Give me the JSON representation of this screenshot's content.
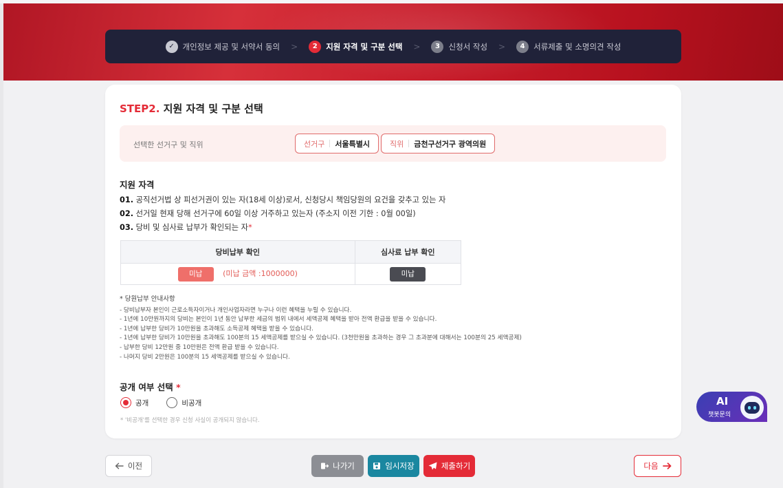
{
  "steps": [
    {
      "num": "✓",
      "label": "개인정보 제공 및 서약서 동의",
      "state": "done"
    },
    {
      "num": "2",
      "label": "지원 자격 및 구분 선택",
      "state": "active"
    },
    {
      "num": "3",
      "label": "신청서 작성",
      "state": "pending"
    },
    {
      "num": "4",
      "label": "서류제출 및 소명의견 작성",
      "state": "pending"
    }
  ],
  "step_separator": ">",
  "card": {
    "title_prefix": "STEP2.",
    "title": "지원 자격 및 구분 선택"
  },
  "district": {
    "label": "선택한 선거구 및 직위",
    "district_key": "선거구",
    "district_value": "서울특별시",
    "position_key": "직위",
    "position_value": "금천구선거구 광역의원"
  },
  "qualification": {
    "title": "지원 자격",
    "items": [
      {
        "num": "01.",
        "text": "공직선거법 상 피선거권이 있는 자(18세 이상)로서, 신청당시 책임당원의 요건을 갖추고 있는 자"
      },
      {
        "num": "02.",
        "text": "선거일 현재 당해 선거구에 60일 이상 거주하고 있는자 (주소지 이전 기한 : 0월 00일)"
      },
      {
        "num": "03.",
        "text": "당비 및 심사료 납부가 확인되는 자",
        "required_mark": "*"
      }
    ]
  },
  "payment_table": {
    "headers": [
      "당비납부 확인",
      "심사료 납부 확인"
    ],
    "dues_status": "미납",
    "dues_amount": "(미납 금액 :1000000)",
    "fee_status": "미납"
  },
  "notes": {
    "head": "* 당원납부 안내사항",
    "lines": [
      "- 당비납부자 본인이 근로소득자이거나 개인사업자라면 누구나 이런 혜택을 누릴 수 있습니다.",
      "- 1년에 10만원까지의 당비는 본인이 1년 동안 납부한 세금의 범위 내에서 세액공제 혜택을 받아 전액 환급을 받을 수 있습니다.",
      "- 1년에 납부한 당비가 10만원을 초과해도 소득공제 혜택을 받을 수 있습니다.",
      "- 1년에 납부한 당비가 10만원을 초과해도 100분의 15 세액공제를 받으실 수 있습니다. (3천만원을 초과하는 경우 그 초과분에 대해서는 100분의 25 세액공제)",
      "- 납부한 당비 12만원 중 10만원은 전액 환급 받을 수 있습니다.",
      "- 나머지 당비 2만원은 100분의 15 세액공제를 받으실 수 있습니다."
    ]
  },
  "disclosure": {
    "title": "공개 여부 선택",
    "required_mark": "*",
    "option_public": "공개",
    "option_private": "비공개",
    "selected": "공개",
    "note": "* '비공개'를 선택한 경우 신청 사실이 공개되지 않습니다."
  },
  "buttons": {
    "prev": "이전",
    "exit": "나가기",
    "save": "임시저장",
    "submit": "제출하기",
    "next": "다음"
  },
  "chatbot": {
    "ai": "AI",
    "label": "챗봇문의"
  },
  "colors": {
    "accent": "#e42b37",
    "navy": "#202239",
    "save": "#1a87a0"
  }
}
